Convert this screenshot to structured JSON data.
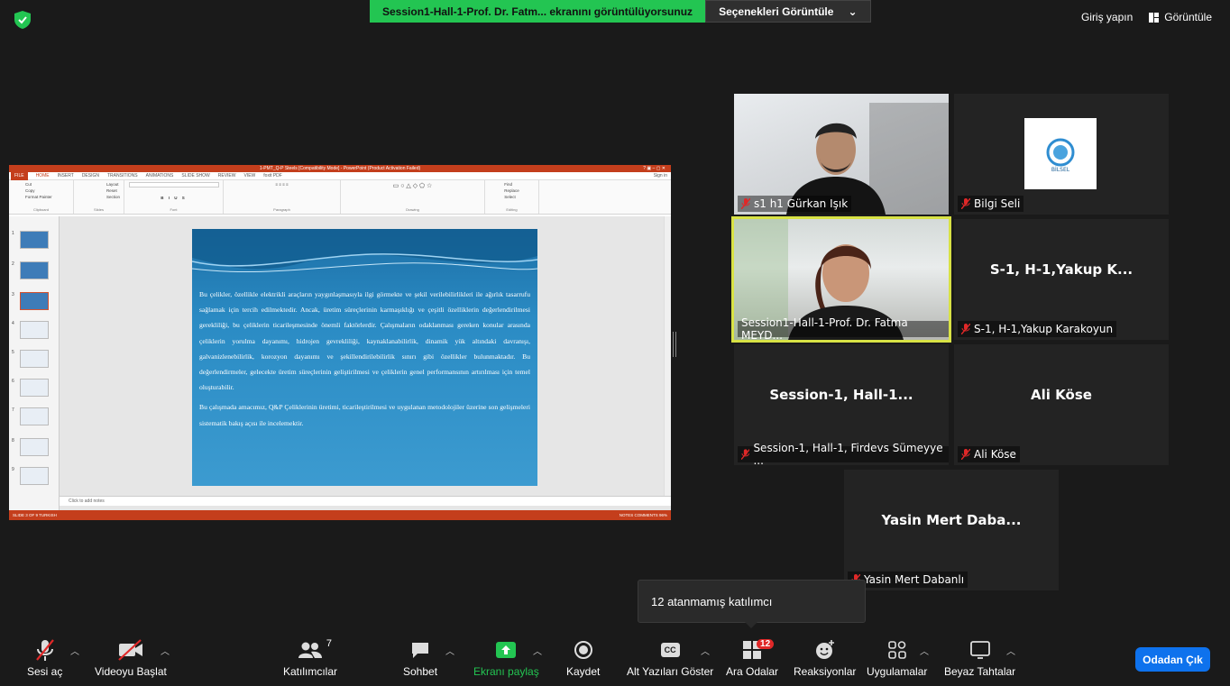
{
  "top": {
    "share_notice": "Session1-Hall-1-Prof. Dr. Fatm... ekranını görüntülüyorsunuz",
    "view_options": "Seçenekleri Görüntüle",
    "sign_in": "Giriş yapın",
    "view": "Görüntüle"
  },
  "powerpoint": {
    "title": "1-PMT_Q-P Steels [Compatibility Mode] - PowerPoint (Product Activation Failed)",
    "sign_in": "Sign in",
    "tabs": [
      "FILE",
      "HOME",
      "INSERT",
      "DESIGN",
      "TRANSITIONS",
      "ANIMATIONS",
      "SLIDE SHOW",
      "REVIEW",
      "VIEW",
      "foxit PDF"
    ],
    "groups": [
      "Clipboard",
      "Slides",
      "Font",
      "Paragraph",
      "Drawing",
      "Editing"
    ],
    "clipboard_items": [
      "Cut",
      "Copy",
      "Format Painter"
    ],
    "slides_items": [
      "Layout",
      "Reset",
      "Section"
    ],
    "editing_items": [
      "Find",
      "Replace",
      "Select"
    ],
    "slide_numbers": [
      "1",
      "2",
      "3",
      "4",
      "5",
      "6",
      "7",
      "8",
      "9"
    ],
    "slide_text_1": "Bu çelikler, özellikle elektrikli araçların yaygınlaşmasıyla ilgi görmekte ve şekil verilebilirlikleri ile ağırlık tasarrufu sağlamak için tercih edilmektedir. Ancak, üretim süreçlerinin karmaşıklığı ve çeşitli özelliklerin değerlendirilmesi gerekliliği, bu çeliklerin ticarileşmesinde önemli faktörlerdir. Çalışmaların odaklanması gereken konular arasında çeliklerin yorulma dayanımı, hidrojen gevrekliliği, kaynaklanabilirlik, dinamik yük altındaki davranışı, galvanizlenebilirlik, korozyon dayanımı ve şekillendirilebilirlik sınırı gibi özellikler bulunmaktadır. Bu değerlendirmeler, gelecekte üretim süreçlerinin geliştirilmesi ve çeliklerin genel performansının artırılması için temel oluşturabilir.",
    "slide_text_2": "Bu çalışmada amacımız, Q&P Çeliklerinin üretimi, ticarileştirilmesi ve uygulanan metodolojiler üzerine son gelişmeleri sistematik bakış açısı ile incelemektir.",
    "notes_placeholder": "Click to add notes",
    "status_left": "SLIDE 3 OF 9   TURKISH",
    "status_right": "NOTES   COMMENTS   96%"
  },
  "tiles": [
    {
      "name": "s1 h1 Gürkan Işık",
      "big": ""
    },
    {
      "name": "Bilgi Seli",
      "big": "",
      "logo_text": "BİLSEL"
    },
    {
      "name": "Session1-Hall-1-Prof. Dr. Fatma MEYD...",
      "big": ""
    },
    {
      "name": "S-1, H-1,Yakup Karakoyun",
      "big": "S-1, H-1,Yakup K..."
    },
    {
      "name": "Session-1, Hall-1, Firdevs Sümeyye ...",
      "big": "Session-1, Hall-1..."
    },
    {
      "name": "Ali Köse",
      "big": "Ali Köse"
    },
    {
      "name": "Yasin Mert Dabanlı",
      "big": "Yasin Mert Daba..."
    }
  ],
  "tooltip": "12 atanmamış katılımcı",
  "toolbar": {
    "unmute": "Sesi aç",
    "start_video": "Videoyu Başlat",
    "participants": "Katılımcılar",
    "participants_count": "7",
    "chat": "Sohbet",
    "share_screen": "Ekranı paylaş",
    "record": "Kaydet",
    "captions": "Alt Yazıları Göster",
    "cc": "CC",
    "breakout": "Ara Odalar",
    "breakout_count": "12",
    "reactions": "Reaksiyonlar",
    "apps": "Uygulamalar",
    "whiteboard": "Beyaz Tahtalar",
    "leave": "Odadan Çık"
  },
  "colors": {
    "share_green": "#23c552",
    "powerpoint_red": "#c43e1c",
    "active_speaker": "#d8e245",
    "leave_blue": "#0e72ed",
    "mute_red": "#e02828"
  }
}
